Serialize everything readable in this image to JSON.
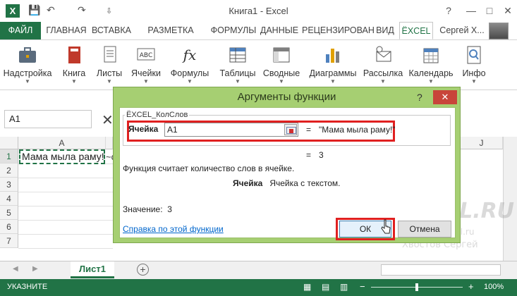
{
  "window": {
    "title": "Книга1 - Excel",
    "app_icon": "X",
    "help_glyph": "?",
    "minimize_glyph": "—",
    "maximize_glyph": "□",
    "close_glyph": "✕"
  },
  "quick_access": {
    "save_glyph": "💾",
    "undo_glyph": "↶",
    "redo_glyph": "↷",
    "customize_glyph": "⇩"
  },
  "tabs": [
    {
      "label": "ФАЙЛ"
    },
    {
      "label": "ГЛАВНАЯ"
    },
    {
      "label": "ВСТАВКА"
    },
    {
      "label": "РАЗМЕТКА СТРА"
    },
    {
      "label": "ФОРМУЛЫ"
    },
    {
      "label": "ДАННЫЕ"
    },
    {
      "label": "РЕЦЕНЗИРОВАН"
    },
    {
      "label": "ВИД"
    },
    {
      "label": "ЁXCEL",
      "active": true
    }
  ],
  "user": {
    "name": "Сергей Х..."
  },
  "ribbon": [
    {
      "label": "Надстройка",
      "icon": "briefcase-icon"
    },
    {
      "label": "Книга",
      "icon": "book-icon"
    },
    {
      "label": "Листы",
      "icon": "sheets-icon"
    },
    {
      "label": "Ячейки",
      "icon": "cells-icon"
    },
    {
      "label": "Формулы",
      "icon": "fx-icon"
    },
    {
      "label": "Таблицы",
      "icon": "tables-icon"
    },
    {
      "label": "Сводные",
      "icon": "pivot-icon"
    },
    {
      "label": "Диаграммы",
      "icon": "chart-icon"
    },
    {
      "label": "Рассылка",
      "icon": "mail-icon"
    },
    {
      "label": "Календарь",
      "icon": "calendar-icon"
    },
    {
      "label": "Инфо",
      "icon": "info-icon"
    }
  ],
  "ribbon_icon_labels": {
    "cells": "ABC",
    "formulas": "fx"
  },
  "formula_bar": {
    "name_box": "A1",
    "cancel_glyph": "✕"
  },
  "grid": {
    "columns": [
      "A",
      "J"
    ],
    "rows": [
      "1",
      "2",
      "3",
      "4",
      "5",
      "6",
      "7"
    ],
    "a1_value": "Мама мыла раму!",
    "a1_overflow": "~с"
  },
  "sheets": [
    {
      "name": "Лист1"
    }
  ],
  "add_sheet_glyph": "+",
  "status": {
    "mode": "УКАЗНИТЕ",
    "zoom_minus": "−",
    "zoom_plus": "+",
    "zoom": "100%"
  },
  "dialog": {
    "title": "Аргументы функции",
    "function_name": "ЁXCEL_КолСлов",
    "arg_label": "Ячейка",
    "arg_input": "A1",
    "arg_equals": "=",
    "arg_value": "\"Мама мыла раму!\"",
    "result_equals": "=",
    "result_value": "3",
    "description": "Функция считает количество слов в ячейке.",
    "arg_desc_name": "Ячейка",
    "arg_desc_text": "Ячейка с текстом.",
    "value_label": "Значение:",
    "value": "3",
    "help_link": "Справка по этой функции",
    "ok_label": "ОК",
    "cancel_label": "Отмена"
  },
  "watermark": {
    "brand": "ЁXCEL.RU",
    "site": "www.e-xcel.ru",
    "author": "Хвостов Сергей"
  },
  "colors": {
    "excel_green": "#217346",
    "dialog_frame": "#a6cf72",
    "highlight_red": "#e02020"
  }
}
